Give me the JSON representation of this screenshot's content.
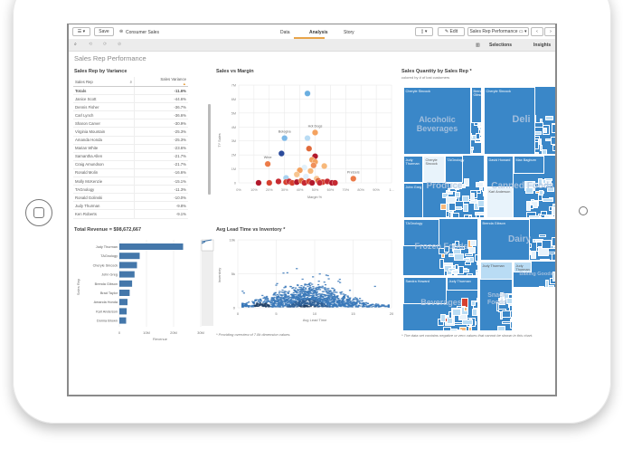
{
  "toolbar": {
    "save": "Save",
    "app_name": "Consumer Sales",
    "tabs": [
      "Data",
      "Analysis",
      "Story"
    ],
    "active_tab": "Analysis",
    "edit": "Edit",
    "sheet": "Sales Rep Performance",
    "selections": "Selections",
    "insights": "Insights"
  },
  "sheet_title": "Sales Rep Performance",
  "variance_table": {
    "title": "Sales Rep by Variance",
    "headers": [
      "Sales Rep",
      "Sales Variance"
    ],
    "totals": [
      "Totals",
      "-11.6%"
    ],
    "rows": [
      [
        "Janice Scott",
        "-44.6%"
      ],
      [
        "Dennis Fisher",
        "-36.7%"
      ],
      [
        "Carl Lynch",
        "-36.6%"
      ],
      [
        "Sharon Carver",
        "-30.9%"
      ],
      [
        "Virginia Mountain",
        "-25.3%"
      ],
      [
        "Amanda Honda",
        "-25.3%"
      ],
      [
        "Marian White",
        "-23.6%"
      ],
      [
        "Samantha Allen",
        "-21.7%"
      ],
      [
        "Craig Amundson",
        "-21.7%"
      ],
      [
        "Ronald Molin",
        "-16.6%"
      ],
      [
        "Molly McKenzie",
        "-15.1%"
      ],
      [
        "TAGnology",
        "-11.3%"
      ],
      [
        "Ronald Golinski",
        "-10.0%"
      ],
      [
        "Judy Thurman",
        "-9.8%"
      ],
      [
        "Ken Roberts",
        "-9.1%"
      ]
    ]
  },
  "chart_data": [
    {
      "type": "bar",
      "title": "Total Revenue = $98,672,667",
      "orientation": "horizontal",
      "xlabel": "Revenue",
      "ylabel": "Sales Rep",
      "xlim": [
        0,
        30000000
      ],
      "xticks": [
        "0",
        "10M",
        "20M",
        "30M"
      ],
      "categories": [
        "Judy Thurman",
        "TAGnology",
        "Cheryle Sincock",
        "John Greg",
        "Brenda Gibson",
        "Brad Taylor",
        "Amanda Honda",
        "Karl Anderson",
        "Donna Brown"
      ],
      "values": [
        23500000,
        7500000,
        6500000,
        5600000,
        4700000,
        3800000,
        3000000,
        2700000,
        2500000
      ],
      "color": "#4477aa"
    },
    {
      "type": "scatter",
      "title": "Sales vs Margin",
      "xlabel": "Margin %",
      "ylabel": "TY Sales",
      "xlim": [
        0,
        1
      ],
      "ylim": [
        0,
        7000000
      ],
      "xticks": [
        "0%",
        "10%",
        "20%",
        "30%",
        "40%",
        "50%",
        "60%",
        "70%",
        "80%",
        "90%",
        "1..."
      ],
      "yticks": [
        "0",
        "1M",
        "2M",
        "3M",
        "4M",
        "5M",
        "6M",
        "7M"
      ],
      "points": [
        {
          "x": 0.45,
          "y": 6400000,
          "color": "#6aaee0"
        },
        {
          "x": 0.3,
          "y": 3200000,
          "color": "#7db9e8",
          "label": "Bologna"
        },
        {
          "x": 0.45,
          "y": 3200000,
          "color": "#b9dcf4"
        },
        {
          "x": 0.5,
          "y": 3600000,
          "color": "#f4a25f",
          "label": "Hot Dogs"
        },
        {
          "x": 0.28,
          "y": 2100000,
          "color": "#2b4b9b"
        },
        {
          "x": 0.46,
          "y": 2450000,
          "color": "#e06a3a"
        },
        {
          "x": 0.5,
          "y": 1900000,
          "color": "#b2182b"
        },
        {
          "x": 0.19,
          "y": 1350000,
          "color": "#ec7b48",
          "label": "Wine"
        },
        {
          "x": 0.48,
          "y": 1650000,
          "color": "#f4a25f"
        },
        {
          "x": 0.5,
          "y": 1500000,
          "color": "#f4a25f"
        },
        {
          "x": 0.49,
          "y": 1250000,
          "color": "#f0905a"
        },
        {
          "x": 0.56,
          "y": 1200000,
          "color": "#f7b87a"
        },
        {
          "x": 0.43,
          "y": 1100000,
          "color": "#e1f0fa"
        },
        {
          "x": 0.4,
          "y": 900000,
          "color": "#f4a25f"
        },
        {
          "x": 0.47,
          "y": 850000,
          "color": "#f7b87a"
        },
        {
          "x": 0.38,
          "y": 600000,
          "color": "#f7c590"
        },
        {
          "x": 0.44,
          "y": 450000,
          "color": "#e1f0fa"
        },
        {
          "x": 0.31,
          "y": 350000,
          "color": "#a8d2f0"
        },
        {
          "x": 0.75,
          "y": 300000,
          "color": "#ec7b48",
          "label": "Pretzels"
        },
        {
          "x": 0.51,
          "y": 300000,
          "color": "#f7c590"
        },
        {
          "x": 0.13,
          "y": 0,
          "color": "#b2182b"
        },
        {
          "x": 0.2,
          "y": 0,
          "color": "#d6402f"
        },
        {
          "x": 0.26,
          "y": 100000,
          "color": "#c62a32"
        },
        {
          "x": 0.31,
          "y": 50000,
          "color": "#d6402f"
        },
        {
          "x": 0.33,
          "y": 100000,
          "color": "#c62a32"
        },
        {
          "x": 0.35,
          "y": 0,
          "color": "#d6402f"
        },
        {
          "x": 0.38,
          "y": 50000,
          "color": "#b2182b"
        },
        {
          "x": 0.41,
          "y": 150000,
          "color": "#e06a3a"
        },
        {
          "x": 0.43,
          "y": 0,
          "color": "#c62a32"
        },
        {
          "x": 0.46,
          "y": 100000,
          "color": "#d6402f"
        },
        {
          "x": 0.48,
          "y": 0,
          "color": "#b2182b"
        },
        {
          "x": 0.52,
          "y": 150000,
          "color": "#e06a3a"
        },
        {
          "x": 0.55,
          "y": 50000,
          "color": "#d6402f"
        },
        {
          "x": 0.58,
          "y": 100000,
          "color": "#c62a32"
        },
        {
          "x": 0.61,
          "y": 0,
          "color": "#b2182b"
        },
        {
          "x": 0.63,
          "y": 0,
          "color": "#c62a32"
        },
        {
          "x": 0.53,
          "y": 0,
          "color": "#c62a32"
        }
      ]
    },
    {
      "type": "heatmap",
      "title": "Avg Lead Time vs Inventory *",
      "xlabel": "Avg Lead Time",
      "ylabel": "Inventory",
      "xlim": [
        0,
        20
      ],
      "ylim": [
        0,
        10000
      ],
      "xticks": [
        "0",
        "5",
        "10",
        "15",
        "20"
      ],
      "yticks": [
        "0",
        "5k",
        "10k"
      ],
      "note": "* Providing overview of 7.8k dimension values.",
      "color": "#3a78b8"
    },
    {
      "type": "treemap",
      "title": "Sales Quantity by Sales Rep *",
      "subtitle": "colored by # of lost customers",
      "note": "* The data set contains negative or zero values that cannot be shown in this chart.",
      "categories": [
        {
          "name": "Alcoholic Beverages",
          "reps": [
            "Cheryle Sincock",
            "Brenda Gibson"
          ]
        },
        {
          "name": "Deli",
          "reps": [
            "Cheryle Sincock"
          ]
        },
        {
          "name": "Produce",
          "reps": [
            "Judy Thurman",
            "Cheryle Sincock",
            "TAGnology",
            "John Greg"
          ]
        },
        {
          "name": "Canned Foods",
          "reps": [
            "David Howard",
            "Max Bagburn",
            "Karl Anderson"
          ]
        },
        {
          "name": "Frozen Foods",
          "reps": [
            "TAGnology"
          ]
        },
        {
          "name": "Dairy",
          "reps": [
            "Brenda Gibson"
          ]
        },
        {
          "name": "Beverages",
          "reps": [
            "Sandra Howard",
            "Judy Thurman"
          ]
        },
        {
          "name": "Snack Foods",
          "reps": [
            "Judy Thurman"
          ]
        },
        {
          "name": "Baking Goods",
          "reps": [
            "Judy Thurman"
          ]
        }
      ],
      "colors": {
        "base": "#3a87c8",
        "light": "#b9dcf4",
        "pale": "#e8f3fb",
        "orange": "#f7b87a",
        "red": "#d6402f"
      }
    }
  ]
}
